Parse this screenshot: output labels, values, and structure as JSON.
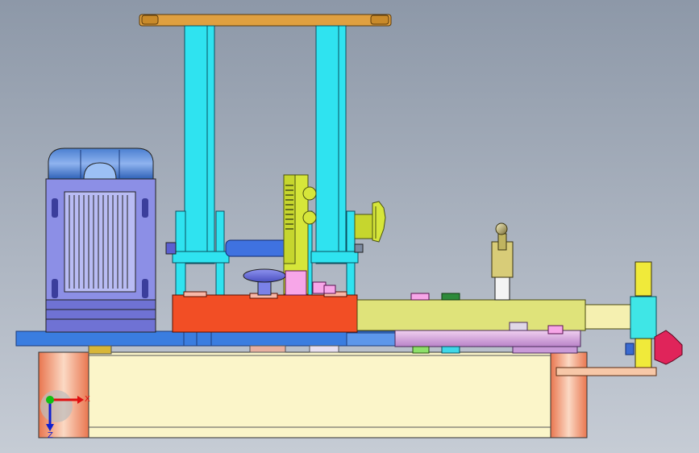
{
  "scene": {
    "description_free": true,
    "colors": {
      "background_top": "#8d98a8",
      "background_bottom": "#c6ccd5",
      "base_cream": "#fbf5c9",
      "base_end": "#e87a55",
      "plate_blue": "#3a7de0",
      "column_cyan": "#2fe3f0",
      "top_plate_orange": "#e0a040",
      "red_block": "#f24e25",
      "yellow_arm": "#dfe37a",
      "motor_blue": "#8c8fe6",
      "knob_magenta": "#e0245a",
      "handwheel_green": "#d6e63a"
    },
    "triad": {
      "x_label": "X",
      "z_label": "Z"
    }
  }
}
